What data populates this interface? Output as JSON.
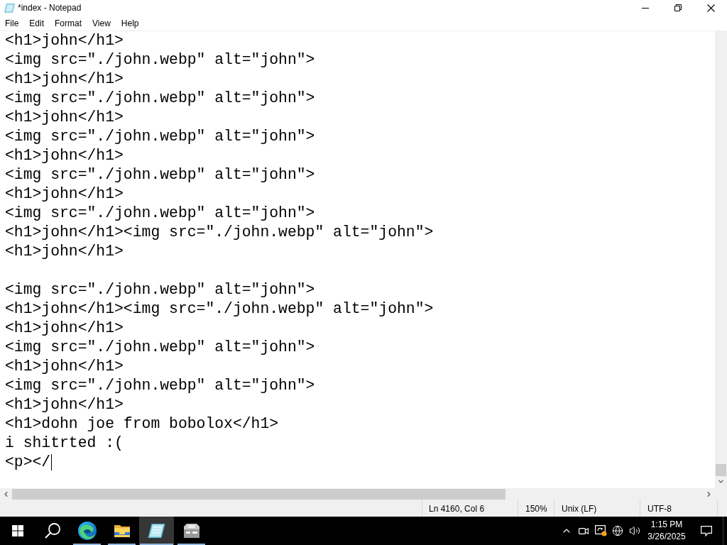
{
  "window": {
    "title": "*index - Notepad"
  },
  "menu": [
    "File",
    "Edit",
    "Format",
    "View",
    "Help"
  ],
  "editor": {
    "focused": true,
    "paragraphs": [
      [
        "<h1>john</h1>",
        "<img src=\"./john.webp\" alt=\"john\">",
        "<h1>john</h1>",
        "<img src=\"./john.webp\" alt=\"john\">",
        "<h1>john</h1>",
        "<img src=\"./john.webp\" alt=\"john\">",
        "<h1>john</h1>",
        "<img src=\"./john.webp\" alt=\"john\">",
        "<h1>john</h1>",
        "<img src=\"./john.webp\" alt=\"john\">",
        "<h1>john</h1><img src=\"./john.webp\" alt=\"john\">",
        "<h1>john</h1>"
      ],
      [
        "<img src=\"./john.webp\" alt=\"john\">",
        "<h1>john</h1><img src=\"./john.webp\" alt=\"john\">",
        "<h1>john</h1>",
        "<img src=\"./john.webp\" alt=\"john\">",
        "<h1>john</h1>",
        "<img src=\"./john.webp\" alt=\"john\">",
        "<h1>john</h1>",
        "<h1>dohn joe from bobolox</h1>",
        "i shitrted :(",
        "<p></"
      ]
    ]
  },
  "status_bar": {
    "position": "Ln 4160, Col 6",
    "zoom": "150%",
    "line_ending": "Unix (LF)",
    "encoding": "UTF-8"
  },
  "taskbar": {
    "items": [
      {
        "kind": "start",
        "running": false,
        "selected": false
      },
      {
        "kind": "search",
        "running": false,
        "selected": false
      },
      {
        "kind": "browser",
        "running": true,
        "selected": false
      },
      {
        "kind": "folder",
        "running": true,
        "selected": false
      },
      {
        "kind": "notepad",
        "running": true,
        "selected": true
      },
      {
        "kind": "device",
        "running": true,
        "selected": false
      }
    ],
    "clock_time": "1:15 PM",
    "clock_date": "3/26/2025"
  }
}
